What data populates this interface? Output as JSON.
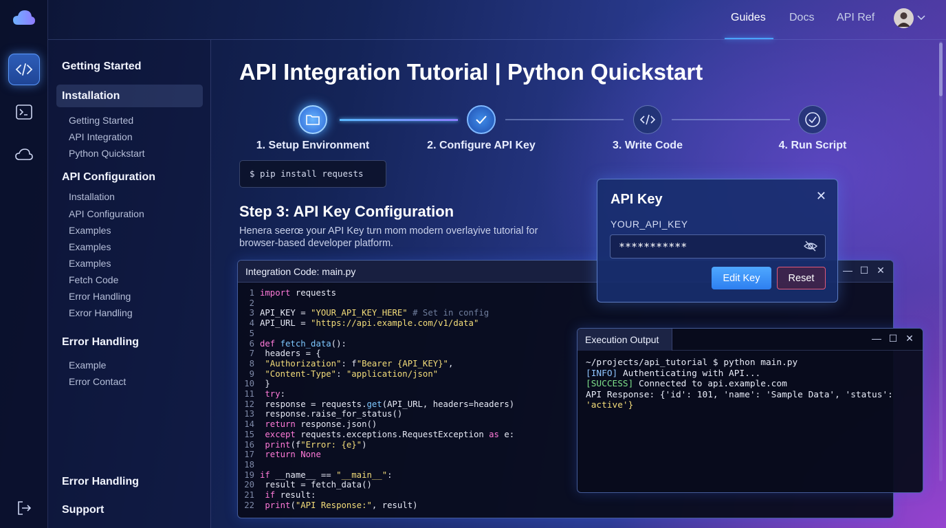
{
  "nav": {
    "links": [
      "Guides",
      "Docs",
      "API Ref"
    ]
  },
  "sidebar": {
    "sections": [
      {
        "head": "Getting Started"
      },
      {
        "head": "Installation",
        "items": [
          "Getting Started",
          "API Integration",
          "Python Quickstart"
        ]
      },
      {
        "head": "API Configuration",
        "items": [
          "Installation",
          "API Configuration",
          "Examples",
          "Examples",
          "Examples",
          "Fetch Code",
          "Error Handling",
          "Exror Handling"
        ]
      },
      {
        "head": "Error Handling",
        "items": [
          "Example",
          "Error Contact"
        ]
      }
    ],
    "footer": [
      "Error Handling",
      "Support"
    ]
  },
  "main": {
    "title": "API Integration Tutorial | Python Quickstart",
    "steps": [
      "1. Setup Environment",
      "2. Configure API Key",
      "3. Write Code",
      "4. Run Script"
    ],
    "command": "$ pip install requests",
    "step_heading": "Step 3: API Key Configuration",
    "description": "Henera seerœ your API Key tưn mom modern overlayive tutorial for browser-based developer platform."
  },
  "code_window": {
    "title": "Integration Code: main.py",
    "lines": [
      "import requests",
      "",
      "API_KEY = \"YOUR_API_KEY_HERE\"  # Set in config",
      "API_URL = \"https://api.example.com/v1/data\"",
      "",
      "def fetch_data():",
      "    headers = {",
      "        \"Authorization\": f\"Bearer {API_KEY}\",",
      "        \"Content-Type\": \"application/json\"",
      "    }",
      "    try:",
      "        response = requests.get(API_URL, headers=headers)",
      "        response.raise_for_status()",
      "        return response.json()",
      "    except requests.exceptions.RequestException as e:",
      "        print(f\"Error: {e}\")",
      "        return None",
      "",
      "if __name__ == \"__main__\":",
      "    result = fetch_data()",
      "    if result:",
      "        print(\"API Response:\", result)"
    ]
  },
  "api_key_popup": {
    "title": "API Key",
    "label": "YOUR_API_KEY",
    "value": "***********",
    "edit_label": "Edit Key",
    "reset_label": "Reset"
  },
  "output_window": {
    "title": "Execution Output",
    "prompt": "~/projects/api_tutorial $ python main.py",
    "info_tag": "[INFO]",
    "info_text": " Authenticating with API...",
    "success_tag": "[SUCCESS]",
    "success_text": " Connected to api.example.com",
    "response_line1": "API Response: {'id': 101, 'name': 'Sample Data', 'status':",
    "response_line2": "'active'}"
  },
  "colors": {
    "accent": "#4aa3ff",
    "success": "#7ee08a",
    "danger": "#e05a7a"
  }
}
